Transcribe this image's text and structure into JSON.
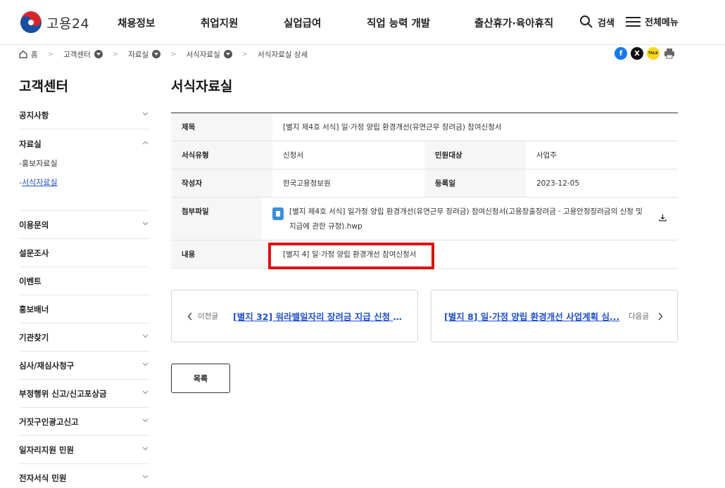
{
  "header": {
    "logo_text": "고용24",
    "nav": [
      "채용정보",
      "취업지원",
      "실업급여",
      "직업 능력 개발",
      "출산휴가·육아휴직"
    ],
    "search_label": "검색",
    "menu_label": "전체메뉴"
  },
  "breadcrumb": {
    "home": "홈",
    "items": [
      "고객센터",
      "자료실",
      "서식자료실",
      "서식자료실 상세"
    ]
  },
  "share": {
    "facebook": "f",
    "x": "X",
    "kakao": "TALK"
  },
  "sidebar": {
    "title": "고객센터",
    "items": [
      "공지사항",
      "자료실",
      "이용문의",
      "설문조사",
      "이벤트",
      "홍보배너",
      "기관찾기",
      "심사/재심사청구",
      "부정행위 신고/신고포상금",
      "거짓구인광고신고",
      "일자리지원 민원",
      "전자서식 민원"
    ],
    "sub_items": [
      "홍보자료실",
      "서식자료실"
    ],
    "sub_prefix": "-"
  },
  "content": {
    "page_title": "서식자료실",
    "labels": {
      "title": "제목",
      "form_type": "서식유형",
      "target": "민원대상",
      "author": "작성자",
      "reg_date": "등록일",
      "attachment": "첨부파일",
      "body": "내용"
    },
    "values": {
      "title": "[별지 제4호 서식] 일·가정 양립 환경개선(유연근무 장려금) 참여신청서",
      "form_type": "신청서",
      "target": "사업주",
      "author": "한국고용정보원",
      "reg_date": "2023-12-05",
      "attachment": "[별지 제4호 서식] 일가정 양립 환경개선(유연근무 장려금) 참여신청서(고용창출장려금 · 고용안정장려금의 신청 및 지급에 관한 규정).hwp",
      "body": "[별지 4] 일·가정 양립 환경개선 참여신청서"
    }
  },
  "pager": {
    "prev_label": "이전글",
    "prev_title": "[별지 32] 워라밸일자리 장려금 지급 신청 결...",
    "next_label": "다음글",
    "next_title": "[별지 8] 일·가정 양립 환경개선 사업계획 심..."
  },
  "list_button": "목록",
  "colors": {
    "link": "#2050c8",
    "highlight": "#e01010",
    "logo_blue": "#1a4fa0",
    "logo_red": "#d8262c"
  }
}
